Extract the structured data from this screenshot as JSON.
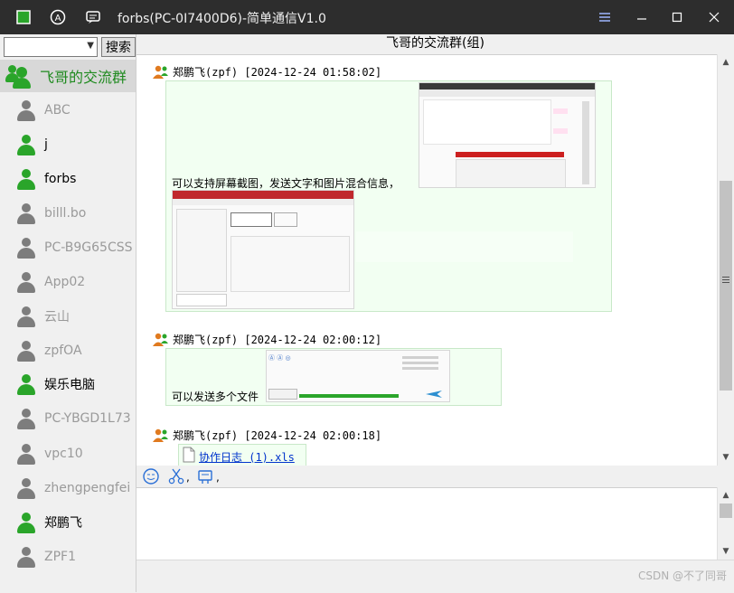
{
  "window": {
    "title": "forbs(PC-0I7400D6)-简单通信V1.0",
    "icons": [
      "app-icon",
      "at-icon",
      "chat-icon"
    ],
    "buttons": [
      "menu-icon",
      "minimize-icon",
      "maximize-icon",
      "close-icon"
    ]
  },
  "sidebar": {
    "search_button": "搜索",
    "group": {
      "label": "飞哥的交流群"
    },
    "contacts": [
      {
        "label": "ABC",
        "status": "offline"
      },
      {
        "label": "j",
        "status": "online"
      },
      {
        "label": "forbs",
        "status": "online"
      },
      {
        "label": "billl.bo",
        "status": "offline"
      },
      {
        "label": "PC-B9G65CSS",
        "status": "offline"
      },
      {
        "label": "App02",
        "status": "offline"
      },
      {
        "label": "云山",
        "status": "offline"
      },
      {
        "label": "zpfOA",
        "status": "offline"
      },
      {
        "label": "娱乐电脑",
        "status": "online"
      },
      {
        "label": "PC-YBGD1L73",
        "status": "offline"
      },
      {
        "label": "vpc10",
        "status": "offline"
      },
      {
        "label": "zhengpengfei",
        "status": "offline"
      },
      {
        "label": "郑鹏飞",
        "status": "online"
      },
      {
        "label": "ZPF1",
        "status": "offline"
      }
    ]
  },
  "chat": {
    "title": "飞哥的交流群(组)",
    "messages": [
      {
        "header": "郑鹏飞(zpf) [2024-12-24 01:58:02]",
        "text": "可以支持屏幕截图，发送文字和图片混合信息，"
      },
      {
        "header": "郑鹏飞(zpf) [2024-12-24 02:00:12]",
        "text": "可以发送多个文件"
      },
      {
        "header": "郑鹏飞(zpf) [2024-12-24 02:00:18]",
        "file": "协作日志 (1).xls"
      }
    ]
  },
  "toolbar": {
    "tools": [
      "emoji-icon",
      "scissors-icon",
      "screenshot-icon"
    ]
  },
  "watermark": "CSDN @不了同哥",
  "colors": {
    "online": "#2aa52a",
    "offline": "#7d7d7d",
    "titlebar": "#2d2d2d",
    "group_text": "#1f8a1f"
  }
}
